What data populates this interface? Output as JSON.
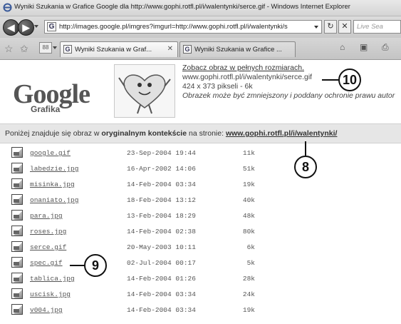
{
  "window": {
    "title": "Wyniki Szukania w Grafice Google dla http://www.gophi.rotfl.pl/i/walentynki/serce.gif - Windows Internet Explorer"
  },
  "nav": {
    "back_glyph": "◀",
    "forward_glyph": "▶",
    "address": "http://images.google.pl/imgres?imgurl=http://www.gophi.rotfl.pl/i/walentynki/s",
    "address_favicon": "G",
    "refresh_glyph": "↻",
    "stop_glyph": "✕",
    "search_placeholder": "Live Sea"
  },
  "tabs": [
    {
      "label": "Wyniki Szukania w Graf...",
      "favicon": "G",
      "close": "✕"
    },
    {
      "label": "Wyniki Szukania w Grafice ...",
      "favicon": "G"
    }
  ],
  "toolbar_icons": {
    "favorites": "☆",
    "add_favorites": "✩",
    "quick_tabs": "88",
    "home": "⌂",
    "feeds": "▣",
    "print": "⎙"
  },
  "logo": {
    "text": "Google",
    "sub": "Grafika"
  },
  "image_info": {
    "link": "Zobacz obraz w pełnych rozmiarach.",
    "url": "www.gophi.rotfl.pl/i/walentynki/serce.gif",
    "dims": "424 x 373 pikseli - 6k",
    "notice": "Obrazek może być zmniejszony i poddany ochronie prawu autor"
  },
  "context": {
    "pre": "Poniżej znajduje się obraz w ",
    "bold": "oryginalnym kontekście",
    "mid": " na stronie: ",
    "link": "www.gophi.rotfl.pl/i/walentynki/"
  },
  "callouts": {
    "c10": "10",
    "c8": "8",
    "c9": "9"
  },
  "files": [
    {
      "name": "google.gif",
      "date": "23-Sep-2004 19:44",
      "size": "11k"
    },
    {
      "name": "labedzie.jpg",
      "date": "16-Apr-2002 14:06",
      "size": "51k"
    },
    {
      "name": "misinka.jpg",
      "date": "14-Feb-2004 03:34",
      "size": "19k"
    },
    {
      "name": "onaniato.jpg",
      "date": "18-Feb-2004 13:12",
      "size": "40k"
    },
    {
      "name": "para.jpg",
      "date": "13-Feb-2004 18:29",
      "size": "48k"
    },
    {
      "name": "roses.jpg",
      "date": "14-Feb-2004 02:38",
      "size": "80k"
    },
    {
      "name": "serce.gif",
      "date": "20-May-2003 10:11",
      "size": "6k"
    },
    {
      "name": "spec.gif",
      "date": "02-Jul-2004 00:17",
      "size": "5k"
    },
    {
      "name": "tablica.jpg",
      "date": "14-Feb-2004 01:26",
      "size": "28k"
    },
    {
      "name": "uscisk.jpg",
      "date": "14-Feb-2004 03:34",
      "size": "24k"
    },
    {
      "name": "v004.jpg",
      "date": "14-Feb-2004 03:34",
      "size": "19k"
    }
  ]
}
